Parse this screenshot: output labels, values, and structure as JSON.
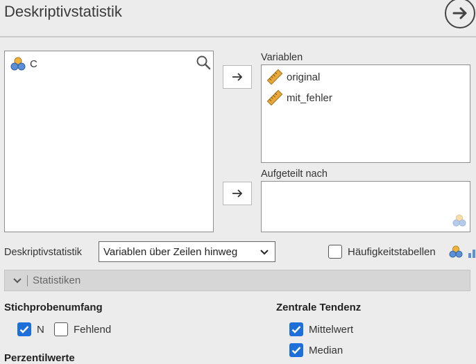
{
  "header": {
    "title": "Deskriptivstatistik"
  },
  "source": {
    "items": [
      {
        "label": "C",
        "icon": "nominal-icon"
      }
    ]
  },
  "variables": {
    "label": "Variablen",
    "items": [
      {
        "label": "original",
        "icon": "ruler-icon"
      },
      {
        "label": "mit_fehler",
        "icon": "ruler-icon"
      }
    ]
  },
  "split": {
    "label": "Aufgeteilt nach"
  },
  "layout_option": {
    "label": "Deskriptivstatistik",
    "selected": "Variablen über Zeilen hinweg"
  },
  "freq_tables": {
    "label": "Häufigkeitstabellen",
    "checked": false
  },
  "statistics_section": {
    "label": "Statistiken"
  },
  "sample_size": {
    "heading": "Stichprobenumfang",
    "n": {
      "label": "N",
      "checked": true
    },
    "missing": {
      "label": "Fehlend",
      "checked": false
    }
  },
  "central_tendency": {
    "heading": "Zentrale Tendenz",
    "mean": {
      "label": "Mittelwert",
      "checked": true
    },
    "median": {
      "label": "Median",
      "checked": true
    }
  },
  "percentiles": {
    "heading": "Perzentilwerte"
  },
  "colors": {
    "accent": "#1e6fd9",
    "ruler": "#e8a93a",
    "nominal_top": "#f0b43c",
    "nominal_bottom": "#5b8fd6"
  }
}
